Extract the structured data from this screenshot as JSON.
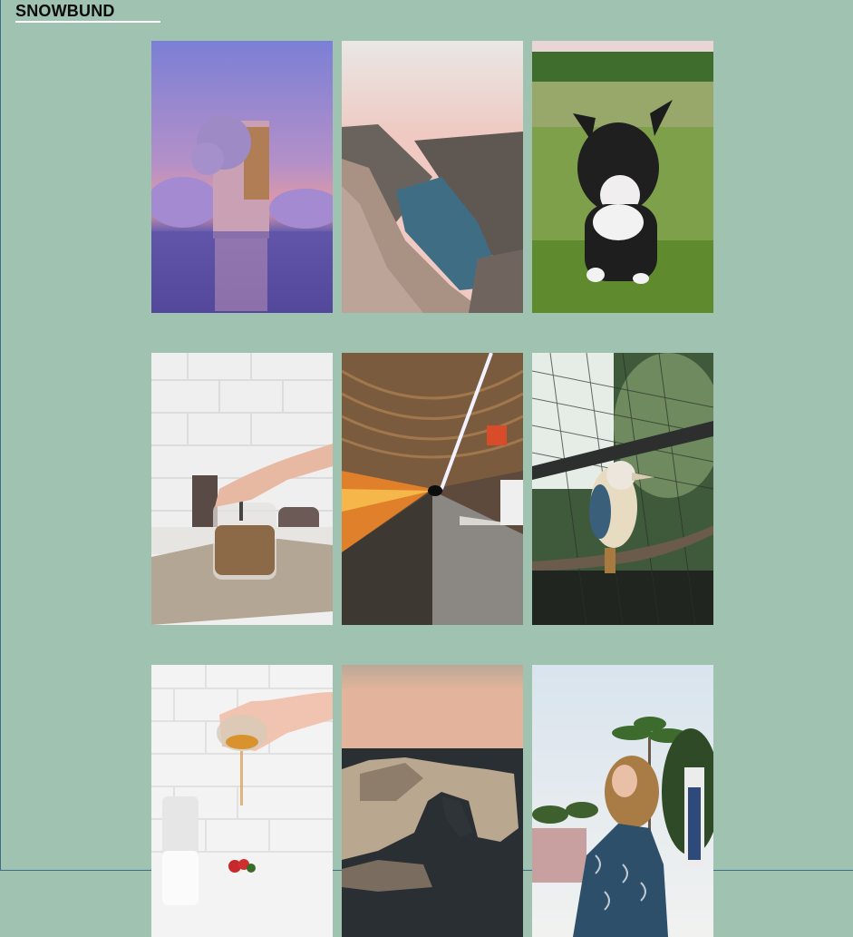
{
  "header": {
    "brand": "SNOWBUND"
  },
  "gallery": {
    "photos": [
      {
        "subject": "surreal-mirror-cloud"
      },
      {
        "subject": "canyon-river"
      },
      {
        "subject": "boston-terrier"
      },
      {
        "subject": "iced-coffee-glass"
      },
      {
        "subject": "metro-station"
      },
      {
        "subject": "kookaburra-bird"
      },
      {
        "subject": "honey-glass-pour"
      },
      {
        "subject": "sea-rock-arch"
      },
      {
        "subject": "woman-palm-trees"
      }
    ]
  },
  "colors": {
    "background": "#a0c3b1",
    "brand_text": "#0b0b0b",
    "underline": "#ffffff"
  }
}
